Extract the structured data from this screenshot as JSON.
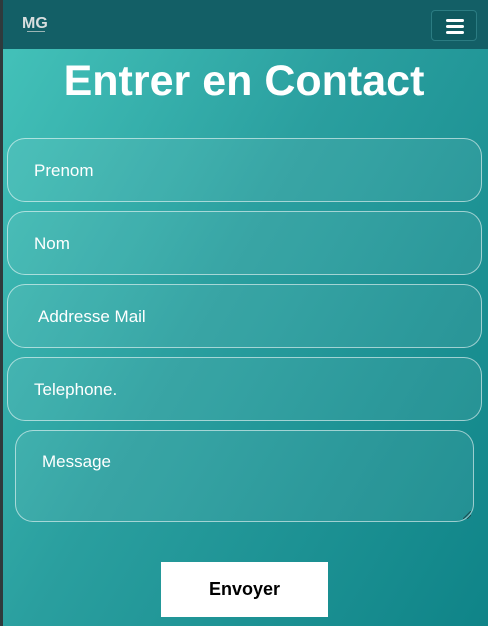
{
  "navbar": {
    "logo_text": "MG",
    "menu_icon": "hamburger-icon"
  },
  "page": {
    "title": "Entrer en Contact"
  },
  "form": {
    "first_name_placeholder": "Prenom",
    "last_name_placeholder": "Nom",
    "email_placeholder": "Addresse Mail",
    "phone_placeholder": "Telephone.",
    "message_placeholder": "Message",
    "submit_label": "Envoyer"
  },
  "colors": {
    "navbar": "#135f66",
    "gradient_start": "#45c4bb",
    "gradient_end": "#0f8488",
    "button_bg": "#ffffff"
  }
}
